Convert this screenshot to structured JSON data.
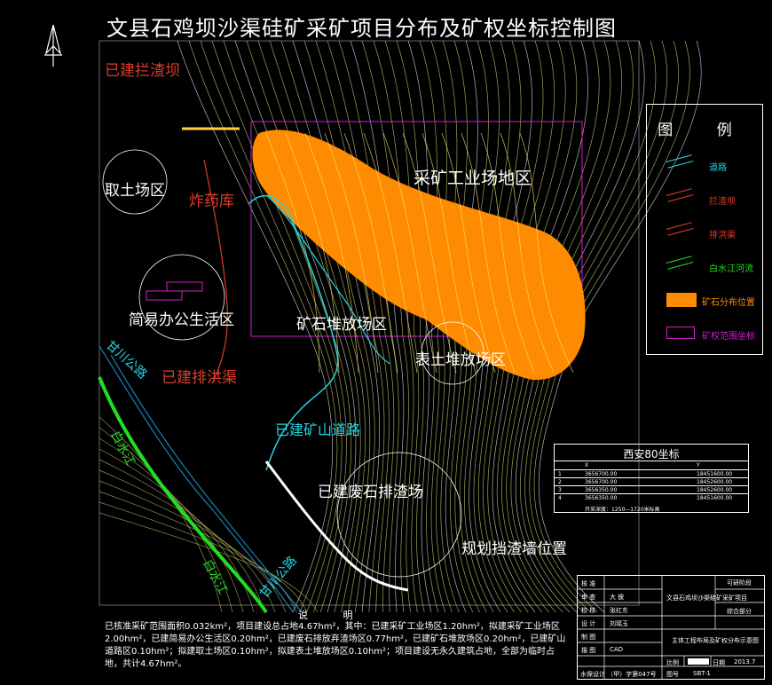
{
  "title": "文县石鸡坝沙渠硅矿采矿项目分布及矿权坐标控制图",
  "zones": {
    "quarry_work": "采矿工业场地区",
    "soil_borrow": "取土场区",
    "explosive_store": "炸药库",
    "office_living": "简易办公生活区",
    "ore_stockpile": "矿石堆放场区",
    "topsoil_stock": "表土堆放场区",
    "flood_channel": "已建排洪渠",
    "mine_road": "已建矿山道路",
    "waste_dump": "已建废石排渣场",
    "retaining_wall": "规划挡渣墙位置",
    "existing_dam": "已建拦渣坝",
    "road_gan": "甘川公路",
    "road_gan2": "甘川公路",
    "river": "白水江",
    "river2": "白水江"
  },
  "legend": {
    "title": "图 例",
    "items": [
      {
        "label": "道路",
        "color": "#23d6e6"
      },
      {
        "label": "拦渣坝",
        "color": "#e03c28"
      },
      {
        "label": "排洪渠",
        "color": "#e03c28"
      },
      {
        "label": "白水江河流",
        "color": "#22dd22"
      },
      {
        "label": "矿石分布位置",
        "color": "#ff8c00"
      },
      {
        "label": "矿权范围坐标",
        "color": "#d020d0"
      }
    ]
  },
  "coords": {
    "title": "西安80坐标",
    "headers": [
      "",
      "X",
      "Y"
    ],
    "rows": [
      [
        "1",
        "3656700.00",
        "18451600.00"
      ],
      [
        "2",
        "3656700.00",
        "18452600.00"
      ],
      [
        "3",
        "3656350.00",
        "18452600.00"
      ],
      [
        "4",
        "3656350.00",
        "18451600.00"
      ]
    ],
    "footnote": "开采深度：1250—1720米标高"
  },
  "notes": {
    "title": "说 明",
    "text": "已核准采矿范围面积0.032km²，项目建设总占地4.67hm²，其中：已建采矿工业场区1.20hm²，拟建采矿工业场区2.00hm²，已建简易办公生活区0.20hm²，已建废石排放弃渣场区0.77hm²，已建矿石堆放场区0.20hm²，已建矿山道路区0.10hm²；拟建取土场区0.10hm²，拟建表土堆放场区0.10hm²；项目建设无永久建筑占地，全部为临时占地，共计4.67hm²。"
  },
  "title_block": {
    "rows_left": [
      "核 准",
      "审 查",
      "校 核",
      "设 计",
      "制 图",
      "描 图"
    ],
    "mid": [
      "",
      "大 彼",
      "张红东",
      "刘瑶玉",
      "",
      "CAD"
    ],
    "project": "文县石鸡坝沙渠硅矿采矿项目",
    "stage": "可研阶段",
    "part": "综合部分",
    "drawing": "主体工程布局及矿权分布示意图",
    "scale_label": "比例",
    "date_label": "日期",
    "date": "2013.7",
    "no_label": "图号",
    "no": "SBT-1",
    "company": "水保设计 （甲）字第047号"
  }
}
